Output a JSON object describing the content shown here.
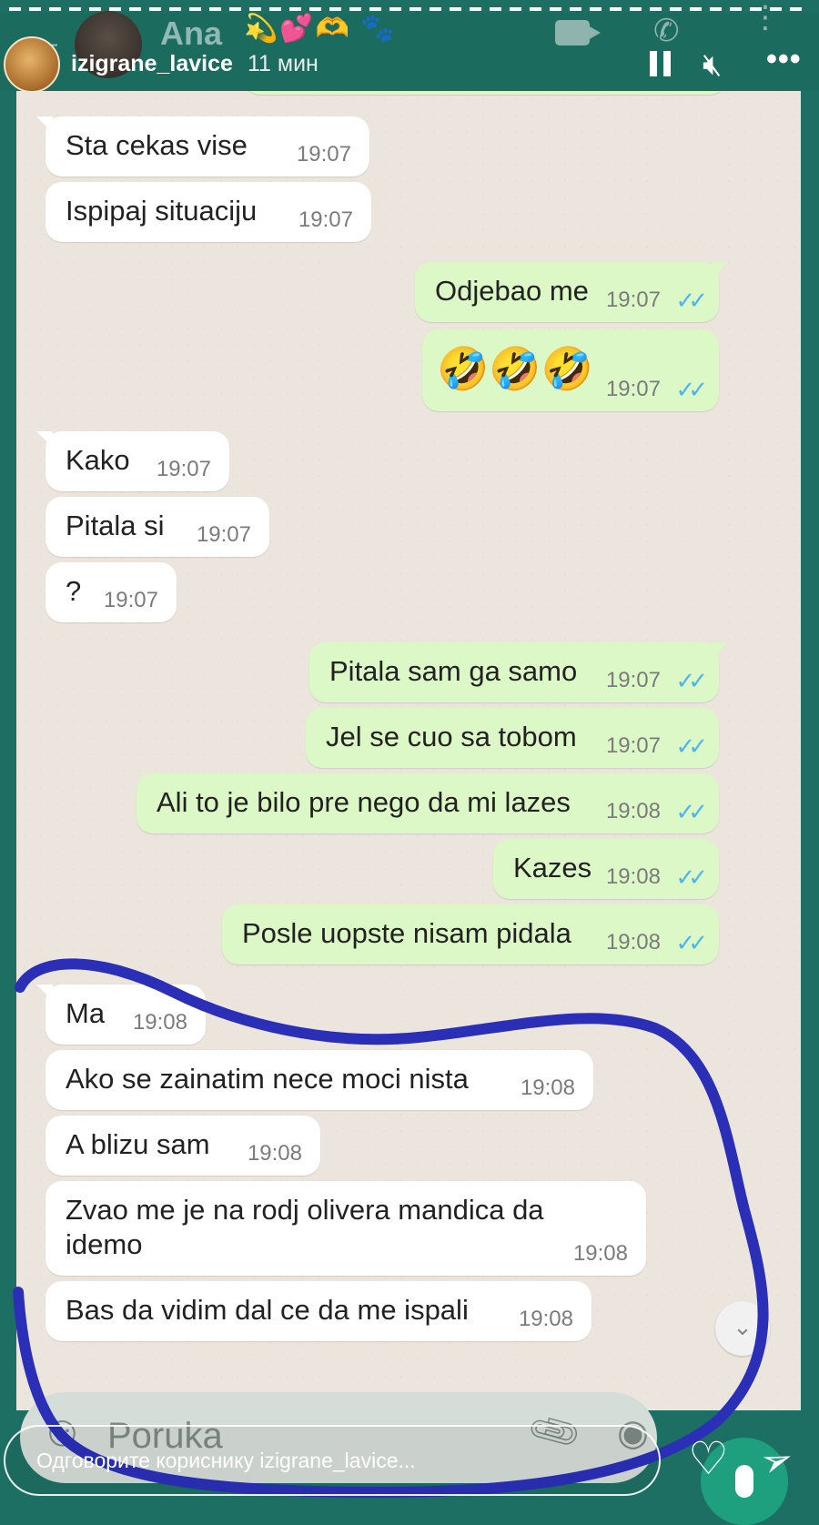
{
  "whatsapp": {
    "contact_name": "Ana",
    "contact_name_emoji": "💫💕🫶 🐾",
    "input_placeholder": "Poruka"
  },
  "story": {
    "username": "izigrane_lavice",
    "time_ago": "11 мин",
    "reply_placeholder": "Одговорите кориснику izigrane_lavice..."
  },
  "messages": [
    {
      "dir": "in",
      "text": "Sta cekas vise",
      "time": "19:07"
    },
    {
      "dir": "in",
      "text": "Ispipaj situaciju",
      "time": "19:07"
    },
    {
      "dir": "out",
      "text": "Odjebao me",
      "time": "19:07"
    },
    {
      "dir": "out",
      "text": "🤣🤣🤣",
      "time": "19:07"
    },
    {
      "dir": "in",
      "text": "Kako",
      "time": "19:07"
    },
    {
      "dir": "in",
      "text": "Pitala si",
      "time": "19:07"
    },
    {
      "dir": "in",
      "text": "?",
      "time": "19:07"
    },
    {
      "dir": "out",
      "text": "Pitala sam ga samo",
      "time": "19:07"
    },
    {
      "dir": "out",
      "text": "Jel se cuo sa tobom",
      "time": "19:07"
    },
    {
      "dir": "out",
      "text": "Ali to je bilo pre nego da mi lazes",
      "time": "19:08"
    },
    {
      "dir": "out",
      "text": "Kazes",
      "time": "19:08"
    },
    {
      "dir": "out",
      "text": "Posle uopste nisam pidala",
      "time": "19:08"
    },
    {
      "dir": "in",
      "text": "Ma",
      "time": "19:08"
    },
    {
      "dir": "in",
      "text": "Ako se zainatim nece moci nista",
      "time": "19:08"
    },
    {
      "dir": "in",
      "text": "A blizu sam",
      "time": "19:08"
    },
    {
      "dir": "in",
      "text": "Zvao me je na rodj olivera mandica da",
      "text2": "idemo",
      "time": "19:08"
    },
    {
      "dir": "in",
      "text": "Bas da vidim dal ce da me ispali",
      "time": "19:08"
    }
  ],
  "colors": {
    "annotation": "#2b2fb8",
    "tick": "#4fb6ec",
    "outgoing_bubble": "#dcf8c6",
    "incoming_bubble": "#ffffff"
  }
}
